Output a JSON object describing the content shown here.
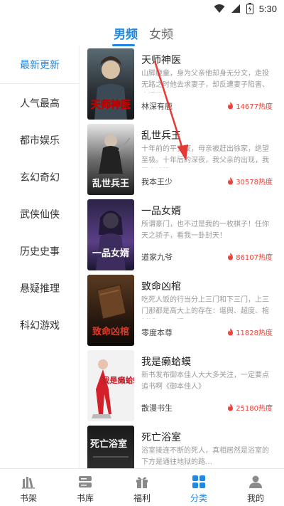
{
  "status_bar": {
    "time": "5:30",
    "icons": [
      "wifi-icon",
      "signal-icon",
      "battery-icon"
    ]
  },
  "gender_tabs": [
    {
      "label": "男频",
      "active": true
    },
    {
      "label": "女频",
      "active": false
    }
  ],
  "sidebar": {
    "items": [
      {
        "label": "最新更新",
        "active": true
      },
      {
        "label": "人气最高"
      },
      {
        "label": "都市娱乐"
      },
      {
        "label": "玄幻奇幻"
      },
      {
        "label": "武侠仙侠"
      },
      {
        "label": "历史史事"
      },
      {
        "label": "悬疑推理"
      },
      {
        "label": "科幻游戏"
      }
    ]
  },
  "books": [
    {
      "title": "天师神医",
      "desc": "山脚鹿童，身为父亲他却身无分文，走投无路之时他去求妻子，却反遭妻子陷害、夺门而出…",
      "author": "林深有鹿",
      "heat": "14677热度",
      "cover_text": "天师神医"
    },
    {
      "title": "乱世兵王",
      "desc": "十年前的平安夜，母亲被赶出徐家，绝望至极。十年后的深夜，我父亲的出现，我再次被推入万…",
      "author": "我本王少",
      "heat": "30578热度",
      "cover_text": "乱世兵王"
    },
    {
      "title": "一品女婿",
      "desc": "所谓豪门，也不过是我的一枚棋子！任你天之骄子，看我一卦封天！",
      "author": "道家九爷",
      "heat": "86107热度",
      "cover_text": "一品女婿"
    },
    {
      "title": "致命凶棺",
      "desc": "吃死人饭的行当分上三门和下三门，上三门那都是高大上的存在：堪舆、超度、棺材铺。下三门…",
      "author": "零度本尊",
      "heat": "11828热度",
      "cover_text": "致命凶棺"
    },
    {
      "title": "我是癞蛤蟆",
      "desc": "新书发布御本佳人大大多关注，一定要点追书啊《御本佳人》",
      "author": "散漫书生",
      "heat": "25180热度",
      "cover_text": "我是癞蛤蟆"
    },
    {
      "title": "死亡浴室",
      "desc": "浴室接连不断的死人，真相居然是浴室的下方是通往地狱的路…",
      "author": "",
      "heat": "",
      "cover_text": "死亡浴室"
    }
  ],
  "bottom_nav": [
    {
      "label": "书架",
      "icon": "bookshelf-icon"
    },
    {
      "label": "书库",
      "icon": "library-icon"
    },
    {
      "label": "福利",
      "icon": "gift-icon"
    },
    {
      "label": "分类",
      "icon": "category-icon",
      "active": true
    },
    {
      "label": "我的",
      "icon": "profile-icon"
    }
  ],
  "colors": {
    "accent": "#1e88e5",
    "heat": "#e8433c",
    "arrow": "#e53935"
  }
}
